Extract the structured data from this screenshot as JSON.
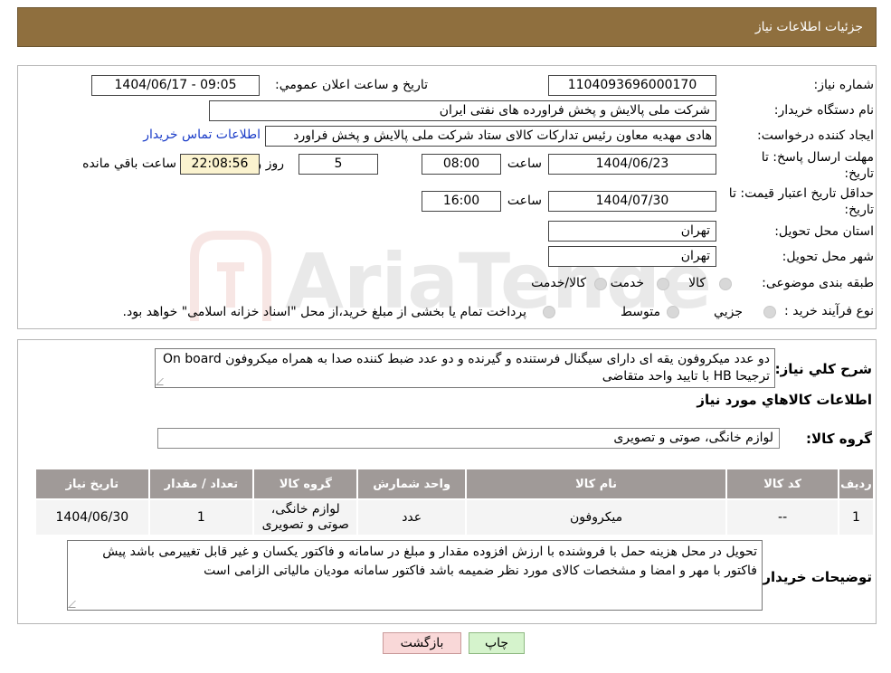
{
  "header": {
    "title": "جزئیات اطلاعات نیاز"
  },
  "form": {
    "need_number_label": "شماره نیاز:",
    "need_number": "1104093696000170",
    "announce_label": "تاریخ و ساعت اعلان عمومي:",
    "announce_value": "1404/06/17 - 09:05",
    "buyer_label": "نام دستگاه خريدار:",
    "buyer_value": "شرکت ملی پالایش و پخش فراورده های نفتی ایران",
    "creator_label": "ايجاد کننده درخواست:",
    "creator_value": "هادی مهدیه معاون رئیس تدارکات کالای ستاد شرکت ملی پالایش و پخش فراورد",
    "contact_link": "اطلاعات تماس خريدار",
    "deadline_label_1": "مهلت ارسال پاسخ: تا",
    "deadline_label_2": "تاريخ:",
    "deadline_date": "1404/06/23",
    "time_label": "ساعت",
    "deadline_time": "08:00",
    "days_value": "5",
    "days_label": "روز و",
    "remaining_value": "22:08:56",
    "remaining_label": "ساعت باقي مانده",
    "validity_label_1": "حداقل تاريخ اعتبار قيمت: تا",
    "validity_label_2": "تاريخ:",
    "validity_date": "1404/07/30",
    "validity_time": "16:00",
    "province_label": "استان محل تحويل:",
    "province_value": "تهران",
    "city_label": "شهر محل تحويل:",
    "city_value": "تهران",
    "category_label": "طبقه بندی موضوعی:",
    "category_options": [
      "کالا",
      "خدمت",
      "کالا/خدمت"
    ],
    "process_label": "نوع فرآيند خريد :",
    "process_options": [
      "جزيي",
      "متوسط"
    ],
    "process_note": "پرداخت تمام يا بخشی از مبلغ خريد،از محل \"اسناد خزانه اسلامی\" خواهد بود."
  },
  "description": {
    "label": "شرح كلي نياز:",
    "text": "دو عدد میکروفون یقه ای دارای سیگنال فرستنده و گیرنده  و دو عدد ضبط کننده صدا به همراه میکروفون On board  ترجیحا HB با تایید واحد متقاضی",
    "goods_info_title": "اطلاعات كالاهاي مورد نياز",
    "group_label": "گروه کالا:",
    "group_value": "لوازم خانگی، صوتی و تصویری"
  },
  "table": {
    "headers": [
      "رديف",
      "کد کالا",
      "نام کالا",
      "واحد شمارش",
      "گروه کالا",
      "تعداد / مقدار",
      "تاريخ نياز"
    ],
    "rows": [
      [
        "1",
        "--",
        "میکروفون",
        "عدد",
        "لوازم خانگی، صوتی و تصویری",
        "1",
        "1404/06/30"
      ]
    ]
  },
  "buyer_notes": {
    "label": "توضيحات خريدار:",
    "text": "تحویل در محل هزینه حمل با فروشنده با ارزش افزوده مقدار و مبلغ در سامانه و فاکتور یکسان و غیر قابل تغییرمی باشد پیش فاکتور با مهر و امضا و مشخصات کالای مورد نظر ضمیمه باشد فاکتور سامانه مودیان مالیاتی الزامی است"
  },
  "buttons": {
    "print": "چاپ",
    "back": "بازگشت"
  },
  "watermark": {
    "text": "AriaTender.neT"
  },
  "colors": {
    "header": "#8f6f3e",
    "link": "#1a3cc8",
    "table_header": "#a09a98",
    "back_button": "#f9d8d8",
    "print_button": "#d5f3cc"
  }
}
